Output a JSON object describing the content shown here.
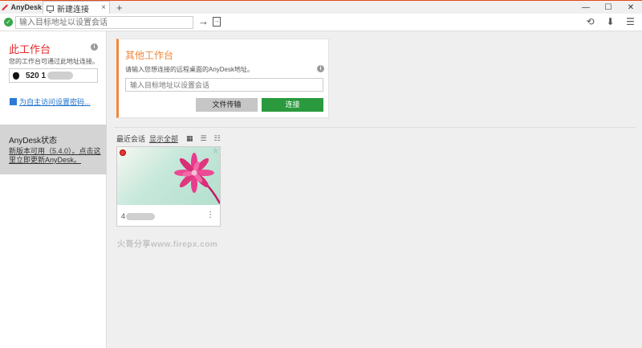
{
  "app": {
    "name": "AnyDesk"
  },
  "tab": {
    "label": "新建连接",
    "close": "×",
    "add": "+"
  },
  "window_controls": {
    "minimize": "—",
    "maximize": "☐",
    "close": "✕"
  },
  "address_bar": {
    "placeholder": "输入目标地址以设置会话",
    "go_symbol": "→"
  },
  "this_desk": {
    "title": "此工作台",
    "description": "您的工作台可通过此地址连接。",
    "address_visible": "520 1",
    "password_link": "为自主访问设置密码..."
  },
  "status": {
    "title": "AnyDesk状态",
    "message": "新版本可用（5.4.0）。点击这里立即更新AnyDesk。"
  },
  "remote_desk": {
    "title": "其他工作台",
    "description": "请输入您想连接的远程桌面的AnyDesk地址。",
    "placeholder": "输入目标地址以设置会话",
    "file_transfer_button": "文件传输",
    "connect_button": "连接"
  },
  "recent": {
    "label": "最近会话",
    "show_all": "显示全部",
    "sessions": [
      {
        "name_visible": "4"
      }
    ]
  },
  "watermark": "火哥分享www.firepx.com",
  "colors": {
    "accent_red": "#e5282b",
    "accent_orange": "#f0883a",
    "connect_green": "#2b9a3e",
    "link_blue": "#1a6fc9"
  }
}
